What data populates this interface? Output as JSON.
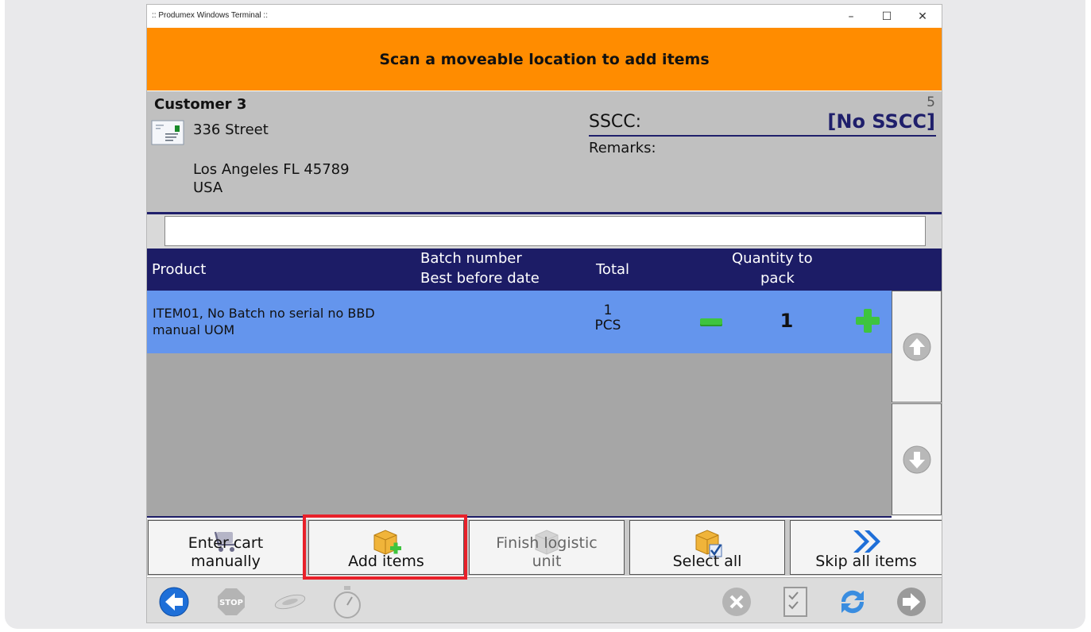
{
  "window": {
    "title": ":: Produmex Windows Terminal ::",
    "minimize": "–",
    "maximize": "☐",
    "close": "✕"
  },
  "banner": {
    "text": "Scan a moveable location to add items"
  },
  "customer": {
    "name": "Customer 3",
    "street": "336 Street",
    "city_line": "Los Angeles FL  45789",
    "country": "USA",
    "counter": "5",
    "sscc_label": "SSCC:",
    "sscc_value": "[No SSCC]",
    "remarks_label": "Remarks:"
  },
  "scan_input": {
    "value": "",
    "placeholder": ""
  },
  "table": {
    "headers": {
      "product": "Product",
      "batch_line1": "Batch number",
      "batch_line2": "Best before date",
      "total": "Total",
      "qty_line1": "Quantity to",
      "qty_line2": "pack"
    },
    "rows": [
      {
        "desc_line1": "ITEM01, No Batch no serial no BBD",
        "desc_line2": "manual UOM",
        "total_qty": "1",
        "total_uom": "PCS",
        "qty_to_pack": "1"
      }
    ]
  },
  "actions": {
    "enter_cart_line1": "Enter cart",
    "enter_cart_line2": "manually",
    "add_items": "Add items",
    "finish_line1": "Finish logistic",
    "finish_line2": "unit",
    "select_all": "Select all",
    "skip_all": "Skip all items"
  },
  "colors": {
    "banner": "#ff8c00",
    "header_navy": "#1c1c66",
    "selected_row": "#6495ed",
    "highlight": "#e8212a",
    "plus_minus_green": "#3ec43e"
  },
  "icons": {
    "back": "back-arrow-icon",
    "stop": "stop-icon",
    "scanner": "scanner-icon",
    "timer": "stopwatch-icon",
    "cancel": "cancel-icon",
    "checklist": "checklist-icon",
    "refresh": "refresh-icon",
    "next": "forward-arrow-icon"
  }
}
